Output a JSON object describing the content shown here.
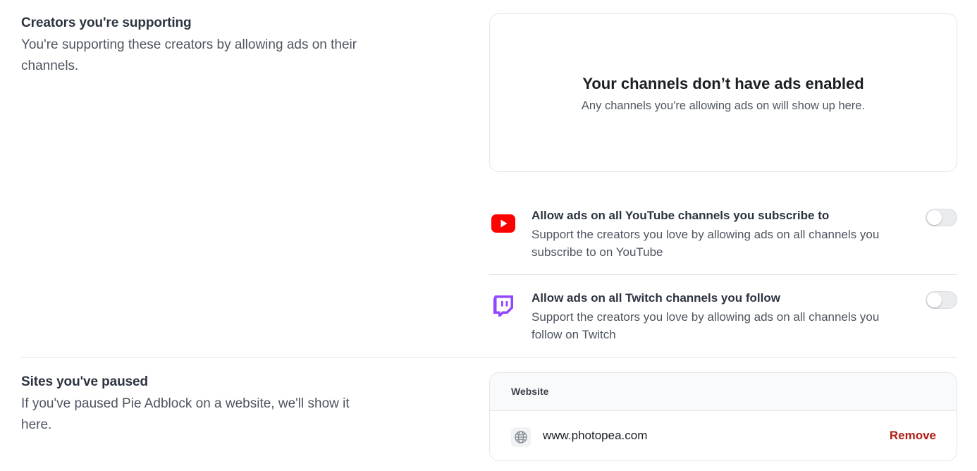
{
  "creators_section": {
    "title": "Creators you're supporting",
    "description": "You're supporting these creators by allowing ads on their channels."
  },
  "empty_state": {
    "title": "Your channels don’t have ads enabled",
    "subtitle": "Any channels you're allowing ads on will show up here."
  },
  "options": [
    {
      "icon": "youtube-icon",
      "title": "Allow ads on all YouTube channels you subscribe to",
      "description": "Support the creators you love by allowing ads on all channels you subscribe to on YouTube",
      "enabled": false
    },
    {
      "icon": "twitch-icon",
      "title": "Allow ads on all Twitch channels you follow",
      "description": "Support the creators you love by allowing ads on all channels you follow on Twitch",
      "enabled": false
    }
  ],
  "paused_section": {
    "title": "Sites you've paused",
    "description": "If you've paused Pie Adblock on a website, we'll show it here."
  },
  "sites_table": {
    "column_header": "Website",
    "rows": [
      {
        "icon": "globe-icon",
        "domain": "www.photopea.com",
        "action_label": "Remove"
      }
    ]
  },
  "colors": {
    "youtube_red": "#ff0000",
    "twitch_purple": "#9146ff",
    "remove_red": "#b01c16"
  }
}
